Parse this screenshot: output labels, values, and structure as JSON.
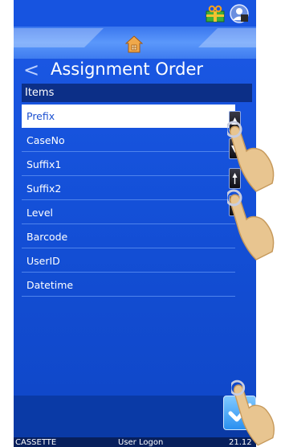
{
  "header": {
    "gift_icon": "gift-icon",
    "user_icon": "user-badge-icon",
    "home_icon": "home-icon"
  },
  "title": {
    "back_glyph": "<",
    "text": "Assignment Order"
  },
  "list": {
    "header": "Items",
    "items": [
      "Prefix",
      "CaseNo",
      "Suffix1",
      "Suffix2",
      "Level",
      "Barcode",
      "UserID",
      "Datetime"
    ],
    "selected_index": 0
  },
  "side_buttons": [
    "move-top-icon",
    "move-bottom-icon",
    "move-up-icon",
    "move-down-icon"
  ],
  "status_bar": {
    "left": "CASSETTE",
    "center": "User Logon",
    "right": "21.12"
  },
  "colors": {
    "screen_bg": "#1450d8",
    "header_band": "#0c2f87",
    "status_bg": "#071f5c",
    "selected_row": "#ffffff"
  }
}
